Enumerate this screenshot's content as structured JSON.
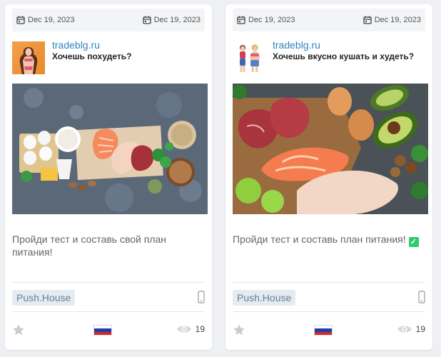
{
  "cards": [
    {
      "date_start": "Dec 19, 2023",
      "date_end": "Dec 19, 2023",
      "brand": "tradeblg.ru",
      "headline": "Хочешь похудеть?",
      "body": "Пройди тест и составь свой план питания!",
      "body_emoji": "",
      "tag": "Push.House",
      "views": "19",
      "country": "Russia",
      "device": "phone-icon"
    },
    {
      "date_start": "Dec 19, 2023",
      "date_end": "Dec 19, 2023",
      "brand": "tradeblg.ru",
      "headline": "Хочешь вкусно кушать и худеть?",
      "body": "Пройди тест и составь план питания! ",
      "body_emoji": "✓",
      "tag": "Push.House",
      "views": "19",
      "country": "Russia",
      "device": "phone-icon"
    }
  ],
  "colors": {
    "brand_link": "#2e86c1",
    "tag_bg": "#e4ecf3",
    "check_green": "#2ecc71"
  }
}
